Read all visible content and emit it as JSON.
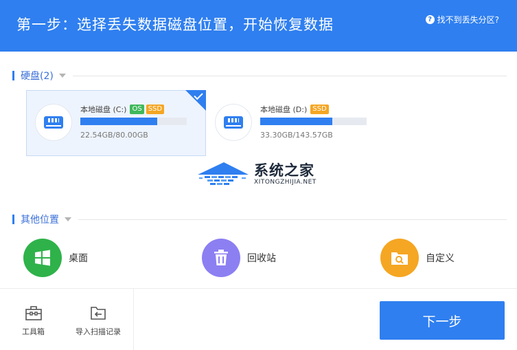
{
  "header": {
    "title": "第一步：选择丢失数据磁盘位置，开始恢复数据",
    "help_label": "找不到丢失分区?",
    "help_icon": "?"
  },
  "disks_section": {
    "label": "硬盘(2)"
  },
  "disks": [
    {
      "name": "本地磁盘 (C:)",
      "badges": [
        "OS",
        "SSD"
      ],
      "usage_text": "22.54GB/80.00GB",
      "used_fraction": 0.72,
      "selected": true
    },
    {
      "name": "本地磁盘 (D:)",
      "badges": [
        "SSD"
      ],
      "usage_text": "33.30GB/143.57GB",
      "used_fraction": 0.68,
      "selected": false
    }
  ],
  "watermark": {
    "title": "系统之家",
    "subtitle": "XITONGZHIJIA.NET"
  },
  "other_section": {
    "label": "其他位置"
  },
  "locations": [
    {
      "label": "桌面",
      "icon": "windows-icon",
      "color": "#2fb24a"
    },
    {
      "label": "回收站",
      "icon": "trash-icon",
      "color": "#8c7ff2"
    },
    {
      "label": "自定义",
      "icon": "folder-search-icon",
      "color": "#f5a623"
    }
  ],
  "footer": {
    "toolbox_label": "工具箱",
    "import_label": "导入扫描记录",
    "next_label": "下一步"
  },
  "colors": {
    "accent": "#2f7ff0",
    "os_badge": "#3fb85a",
    "ssd_badge": "#f5a623"
  }
}
